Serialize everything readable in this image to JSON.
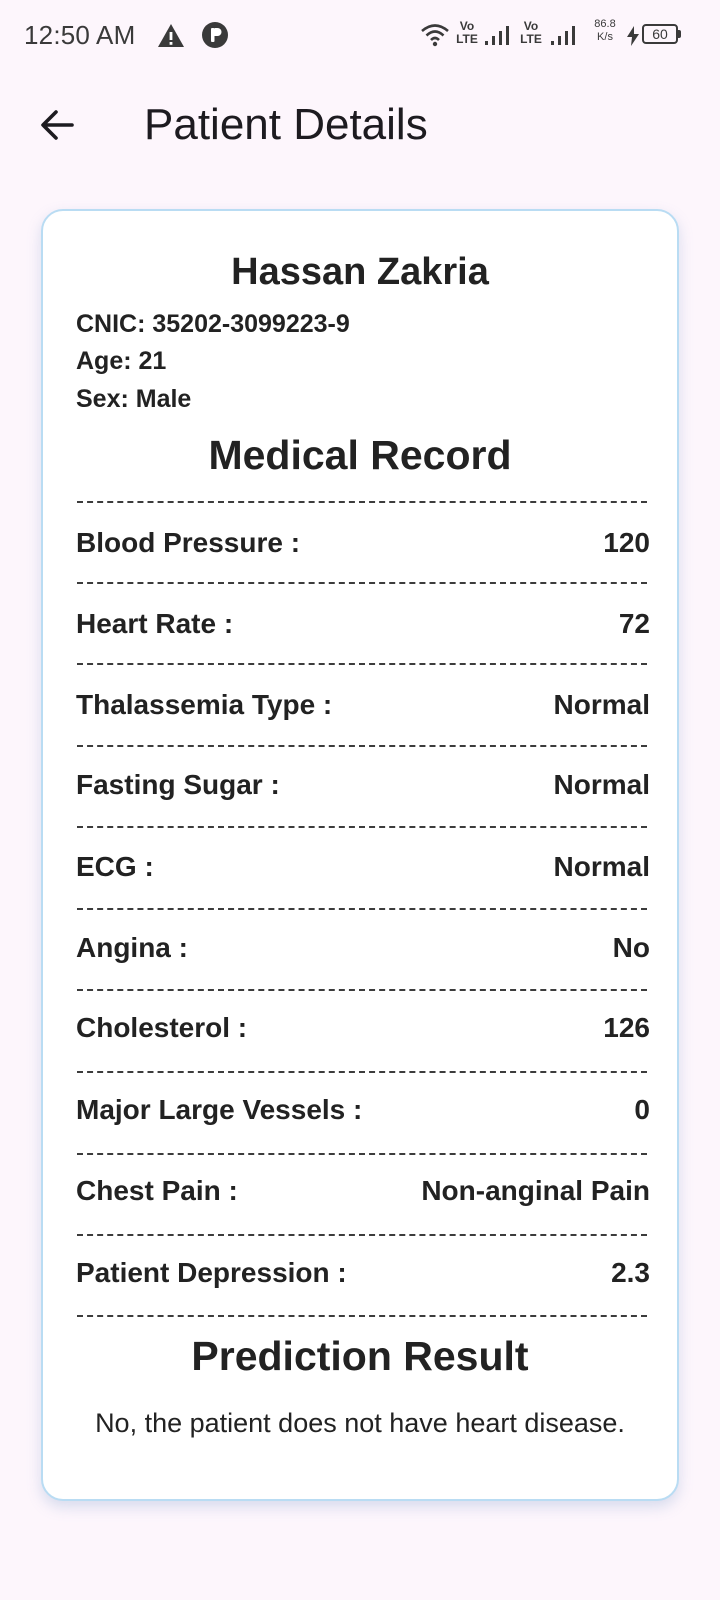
{
  "status_bar": {
    "time": "12:50 AM",
    "network_1": "Vo LTE",
    "network_2": "Vo LTE",
    "speed_value": "86.8",
    "speed_unit": "K/s",
    "battery": "60"
  },
  "app_bar": {
    "title": "Patient Details",
    "back_icon": "arrow-back-icon"
  },
  "patient": {
    "name": "Hassan Zakria",
    "cnic": "CNIC: 35202-3099223-9",
    "age": "Age: 21",
    "sex": "Sex: Male"
  },
  "medical_record": {
    "title": "Medical Record",
    "rows": [
      {
        "label": "Blood Pressure :",
        "value": "120"
      },
      {
        "label": "Heart Rate :",
        "value": "72"
      },
      {
        "label": "Thalassemia Type :",
        "value": "Normal"
      },
      {
        "label": "Fasting Sugar :",
        "value": "Normal"
      },
      {
        "label": "ECG :",
        "value": "Normal"
      },
      {
        "label": "Angina :",
        "value": "No"
      },
      {
        "label": "Cholesterol :",
        "value": "126"
      },
      {
        "label": "Major Large Vessels :",
        "value": "0"
      },
      {
        "label": "Chest Pain :",
        "value": "Non-anginal Pain"
      },
      {
        "label": "Patient Depression :",
        "value": "2.3"
      }
    ]
  },
  "prediction": {
    "title": "Prediction Result",
    "text": "No, the patient does not have heart disease."
  },
  "colors": {
    "background": "#fdf6fc",
    "card_border": "#b9dcf3"
  }
}
